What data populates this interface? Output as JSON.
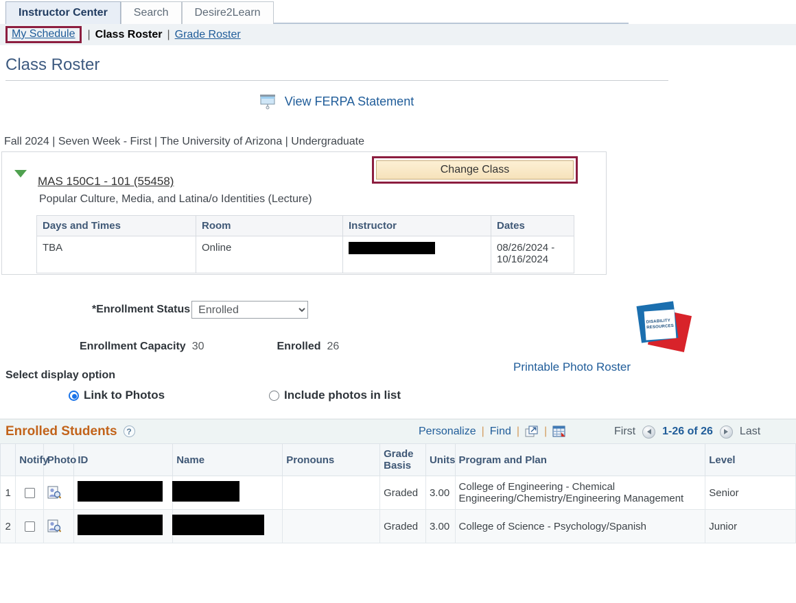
{
  "tabs": [
    {
      "label": "Instructor Center",
      "active": true
    },
    {
      "label": "Search",
      "active": false
    },
    {
      "label": "Desire2Learn",
      "active": false
    }
  ],
  "subnav": {
    "my_schedule": "My Schedule",
    "separator": "|",
    "class_roster": "Class Roster",
    "grade_roster": "Grade Roster"
  },
  "page": {
    "title": "Class Roster",
    "ferpa_link": "View FERPA Statement",
    "ferpa_icon": "projector-screen-icon",
    "term_line": "Fall 2024 | Seven Week - First | The University of Arizona | Undergraduate"
  },
  "class": {
    "expand_icon": "triangle-down-icon",
    "code": "MAS 150C1 - 101 (55458)",
    "name": "Popular Culture, Media, and Latina/o Identities (Lecture)",
    "change_class_button": "Change Class",
    "meeting_headers": [
      "Days and Times",
      "Room",
      "Instructor",
      "Dates"
    ],
    "meeting_rows": [
      {
        "days_and_times": "TBA",
        "room": "Online",
        "instructor": "",
        "instructor_redacted": true,
        "dates": "08/26/2024 - 10/16/2024"
      }
    ]
  },
  "enrollment": {
    "status_label": "*Enrollment Status",
    "status_value": "Enrolled",
    "status_options": [
      "Enrolled"
    ],
    "capacity_label": "Enrollment Capacity",
    "capacity_value": "30",
    "enrolled_label": "Enrolled",
    "enrolled_value": "26"
  },
  "disability": {
    "logo_name": "disability-resources-logo",
    "logo_line1": "DISABILITY",
    "logo_line2": "RESOURCES",
    "blue": "#1b6faf",
    "red": "#d8232a"
  },
  "photo_roster_link": "Printable Photo Roster",
  "display_option": {
    "title": "Select display option",
    "options": [
      {
        "label": "Link to Photos",
        "selected": true
      },
      {
        "label": "Include photos in list",
        "selected": false
      }
    ]
  },
  "roster": {
    "section_title": "Enrolled Students",
    "help_icon": "question-mark-icon",
    "toolbar": {
      "personalize": "Personalize",
      "find": "Find",
      "sep": "|",
      "view_all_icon": "open-in-new-window-icon",
      "download_icon": "download-to-excel-icon"
    },
    "pager": {
      "first": "First",
      "prev_icon": "arrow-left-icon",
      "range": "1-26 of 26",
      "next_icon": "arrow-right-icon",
      "last": "Last"
    },
    "headers": [
      "",
      "Notify",
      "Photo",
      "ID",
      "Name",
      "Pronouns",
      "Grade Basis",
      "Units",
      "Program and Plan",
      "Level"
    ],
    "rows": [
      {
        "index": "1",
        "notify_checked": false,
        "photo_icon": "person-search-icon",
        "id": "",
        "id_redacted": true,
        "name": "",
        "pronouns": "",
        "grade_basis": "Graded",
        "units": "3.00",
        "program_and_plan": "College of Engineering - Chemical Engineering/Chemistry/Engineering Management",
        "level": "Senior"
      },
      {
        "index": "2",
        "notify_checked": false,
        "photo_icon": "person-search-icon",
        "id": "",
        "id_redacted": true,
        "name": "",
        "pronouns": "",
        "grade_basis": "Graded",
        "units": "3.00",
        "program_and_plan": "College of Science - Psychology/Spanish",
        "level": "Junior"
      }
    ]
  },
  "colors": {
    "highlight_border": "#8c1d3f",
    "link": "#1f5c99",
    "section_title": "#c2631a",
    "header_text": "#3f5876"
  }
}
